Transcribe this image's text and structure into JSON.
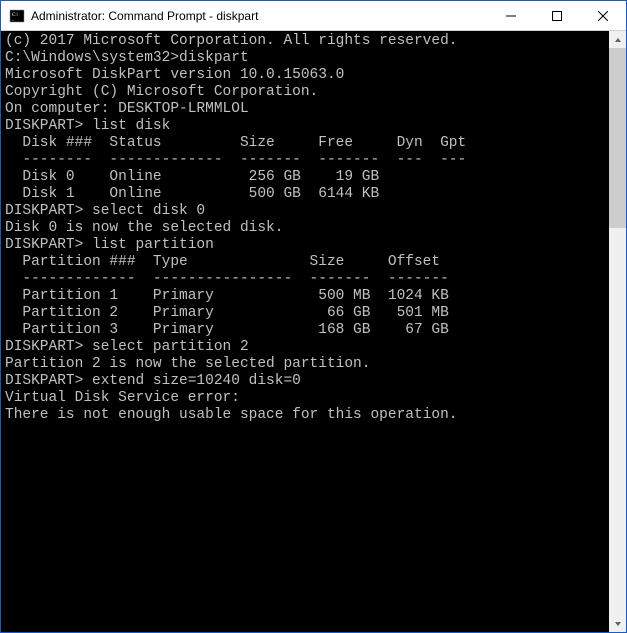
{
  "window": {
    "title": "Administrator: Command Prompt - diskpart"
  },
  "lines": {
    "l0": "(c) 2017 Microsoft Corporation. All rights reserved.",
    "l1": "",
    "l2": "C:\\Windows\\system32>diskpart",
    "l3": "",
    "l4": "Microsoft DiskPart version 10.0.15063.0",
    "l5": "",
    "l6": "Copyright (C) Microsoft Corporation.",
    "l7": "On computer: DESKTOP-LRMMLOL",
    "l8": "",
    "l9": "DISKPART> list disk",
    "l10": "",
    "l11": "  Disk ###  Status         Size     Free     Dyn  Gpt",
    "l12": "  --------  -------------  -------  -------  ---  ---",
    "l13": "  Disk 0    Online          256 GB    19 GB",
    "l14": "  Disk 1    Online          500 GB  6144 KB",
    "l15": "",
    "l16": "DISKPART> select disk 0",
    "l17": "",
    "l18": "Disk 0 is now the selected disk.",
    "l19": "",
    "l20": "DISKPART> list partition",
    "l21": "",
    "l22": "  Partition ###  Type              Size     Offset",
    "l23": "  -------------  ----------------  -------  -------",
    "l24": "  Partition 1    Primary            500 MB  1024 KB",
    "l25": "  Partition 2    Primary             66 GB   501 MB",
    "l26": "  Partition 3    Primary            168 GB    67 GB",
    "l27": "",
    "l28": "DISKPART> select partition 2",
    "l29": "",
    "l30": "Partition 2 is now the selected partition.",
    "l31": "",
    "l32": "DISKPART> extend size=10240 disk=0",
    "l33": "",
    "l34": "Virtual Disk Service error:",
    "l35": "There is not enough usable space for this operation."
  }
}
